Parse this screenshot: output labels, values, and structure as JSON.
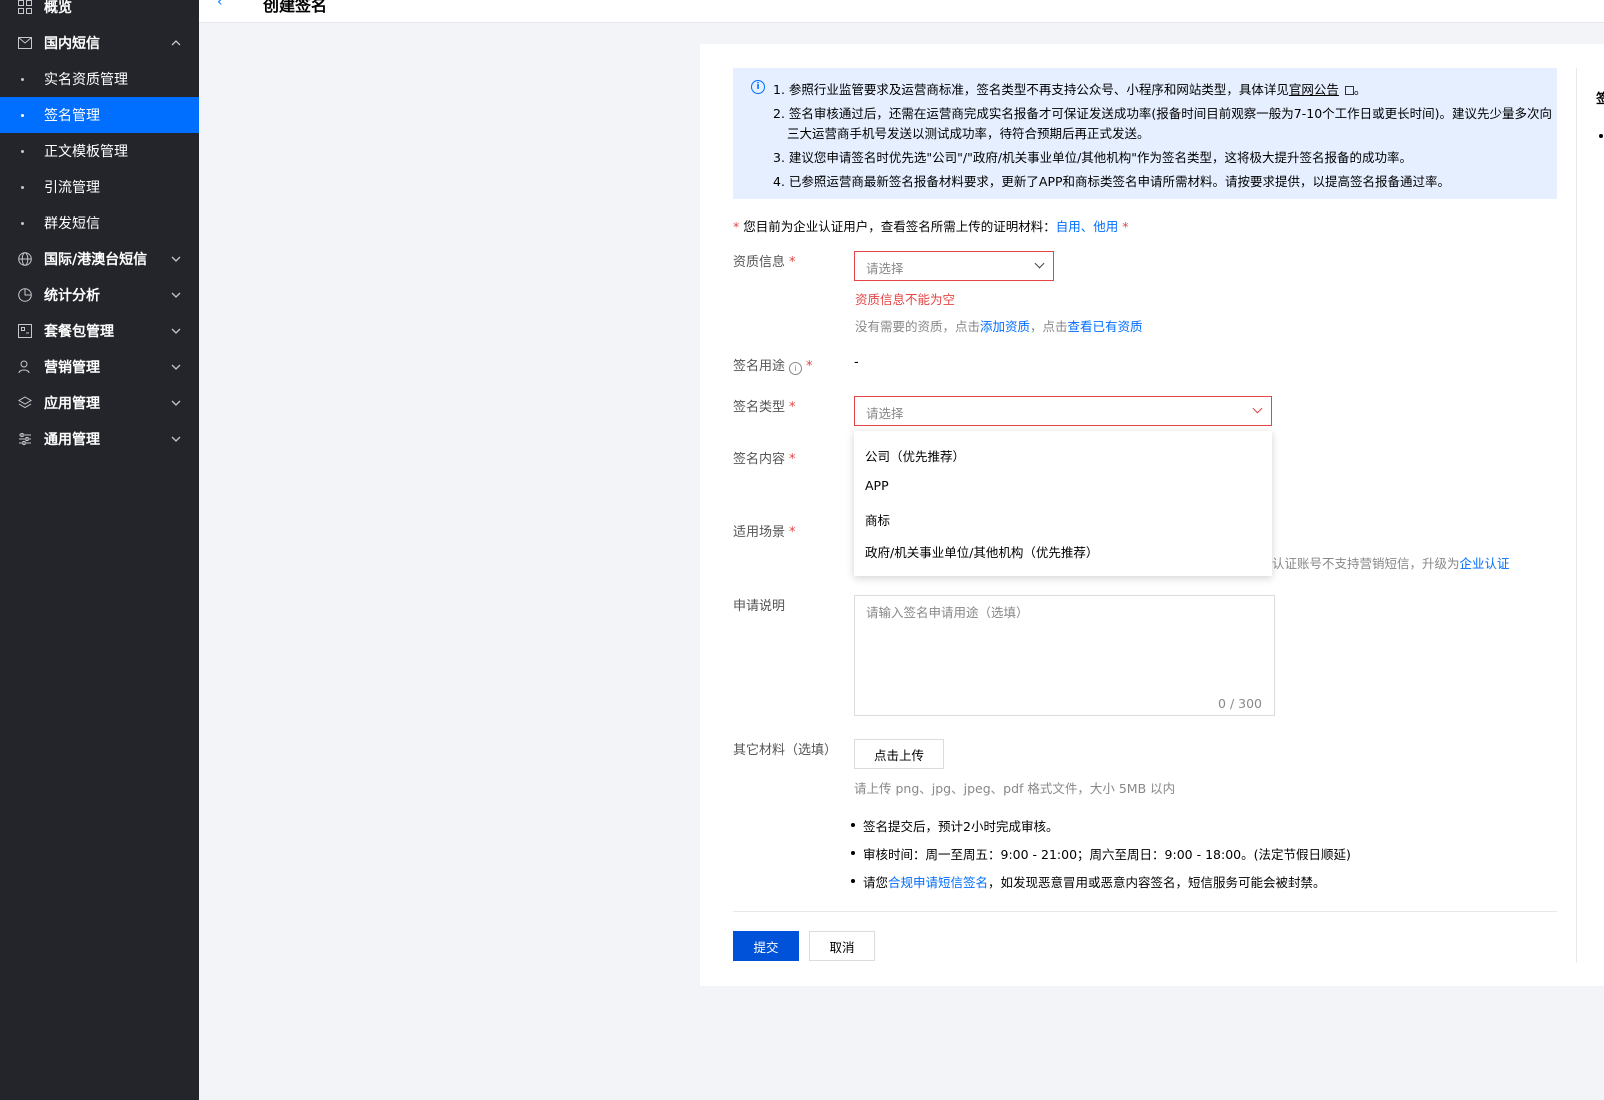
{
  "sidebar": {
    "items": [
      {
        "label": "概览",
        "icon": "grid-icon"
      },
      {
        "label": "国内短信",
        "icon": "mail-icon",
        "expanded": true
      },
      {
        "label": "实名资质管理",
        "sub": true
      },
      {
        "label": "签名管理",
        "sub": true,
        "active": true
      },
      {
        "label": "正文模板管理",
        "sub": true
      },
      {
        "label": "引流管理",
        "sub": true
      },
      {
        "label": "群发短信",
        "sub": true
      },
      {
        "label": "国际/港澳台短信",
        "icon": "globe-icon"
      },
      {
        "label": "统计分析",
        "icon": "pie-chart-icon"
      },
      {
        "label": "套餐包管理",
        "icon": "package-icon"
      },
      {
        "label": "营销管理",
        "icon": "user-group-icon"
      },
      {
        "label": "应用管理",
        "icon": "layers-icon"
      },
      {
        "label": "通用管理",
        "icon": "sliders-icon"
      }
    ]
  },
  "header": {
    "title": "创建签名"
  },
  "notice": {
    "line1_prefix": "1. 参照行业监管要求及运营商标准，签名类型不再支持公众号、小程序和网站类型，具体详见",
    "line1_link": "官网公告",
    "line1_suffix": "。",
    "line2a": "2. 签名审核通过后，还需在运营商完成实名报备才可保证发送成功率(报备时间目前观察一般为7-10个工作日或更长时间)。建议先少量多次向",
    "line2b": "三大运营商手机号发送以测试成功率，待符合预期后再正式发送。",
    "line3": "3. 建议您申请签名时优先选\"公司\"/\"政府/机关事业单位/其他机构\"作为签名类型，这将极大提升签名报备的成功率。",
    "line4": "4. 已参照运营商最新签名报备材料要求，更新了APP和商标类签名申请所需材料。请按要求提供，以提高签名报备通过率。"
  },
  "requirement": {
    "star": "*",
    "text": "您目前为企业认证用户，查看签名所需上传的证明材料：",
    "link1": "自用",
    "sep": "、",
    "link2": "他用",
    "star2": "*"
  },
  "form": {
    "qualification": {
      "label": "资质信息",
      "placeholder": "请选择",
      "error": "资质信息不能为空",
      "hint_prefix": "没有需要的资质，点击",
      "hint_link1": "添加资质",
      "hint_mid": "，点击",
      "hint_link2": "查看已有资质"
    },
    "purpose": {
      "label": "签名用途",
      "value": "-"
    },
    "type": {
      "label": "签名类型",
      "placeholder": "请选择",
      "options": [
        "公司（优先推荐）",
        "APP",
        "商标",
        "政府/机关事业单位/其他机构（优先推荐）"
      ]
    },
    "content": {
      "label": "签名内容"
    },
    "scene": {
      "label": "适用场景",
      "hint_trunc": "认证账号不支持营销短信，升级为",
      "hint_link": "企业认证"
    },
    "description": {
      "label": "申请说明",
      "placeholder": "请输入签名申请用途（选填）",
      "counter": "0 / 300"
    },
    "other": {
      "label": "其它材料（选填）",
      "button": "点击上传",
      "hint": "请上传 png、jpg、jpeg、pdf 格式文件，大小 5MB 以内"
    }
  },
  "bullets": {
    "b1": "签名提交后，预计2小时完成审核。",
    "b2": "审核时间：周一至周五：9:00 - 21:00；周六至周日：9:00 - 18:00。(法定节假日顺延)",
    "b3_prefix": "请您",
    "b3_link": "合规申请短信签名",
    "b3_suffix": "，如发现恶意冒用或恶意内容签名，短信服务可能会被封禁。"
  },
  "actions": {
    "submit": "提交",
    "cancel": "取消"
  },
  "side": {
    "trunc_text": "签"
  },
  "colors": {
    "primary": "#006eff",
    "submit": "#0052d9",
    "error": "#e54545",
    "sidebar": "#23252b",
    "notice_bg": "#e5efff"
  }
}
